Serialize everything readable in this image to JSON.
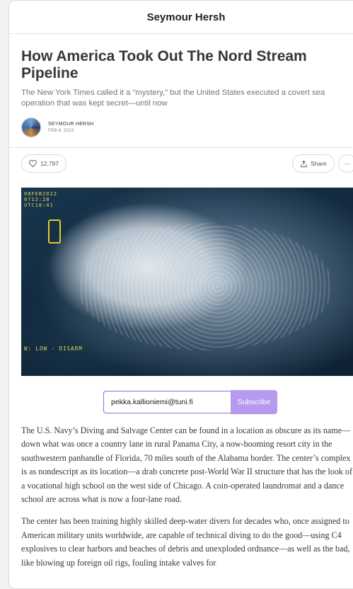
{
  "publication": {
    "name": "Seymour Hersh"
  },
  "article": {
    "title": "How America Took Out The Nord Stream Pipeline",
    "subtitle": "The New York Times called it a “mystery,” but the United States executed a covert sea operation that was kept secret—until now",
    "author": "SEYMOUR HERSH",
    "date": "FEB 8, 2023",
    "likes": "12,797",
    "share_label": "Share",
    "more_label": "···"
  },
  "hero_image": {
    "overlay_stamp_lines": [
      "08FEB2022",
      "0712:28",
      "UTC18:41"
    ],
    "overlay_mode": "W: LOW    - DISARM"
  },
  "subscribe": {
    "email_value": "pekka.kallioniemi@tuni.fi",
    "button_label": "Subscribe"
  },
  "body": {
    "paragraph_1": "The U.S. Navy’s Diving and Salvage Center can be found in a location as obscure as its name—down what was once a country lane in rural Panama City, a now-booming resort city in the southwestern panhandle of Florida, 70 miles south of the Alabama border. The center’s complex is as nondescript as its location—a drab concrete post-World War II structure that has the look of a vocational high school on the west side of Chicago. A coin-operated laundromat and a dance school are across what is now a four-lane road.",
    "paragraph_2": "The center has been training highly skilled deep-water divers for decades who, once assigned to American military units worldwide, are capable of technical diving to do the good—using C4 explosives to clear harbors and beaches of debris and unexploded ordnance—as well as the bad, like blowing up foreign oil rigs, fouling intake valves for"
  },
  "colors": {
    "accent": "#b79aee",
    "input_border": "#8e6be0"
  }
}
